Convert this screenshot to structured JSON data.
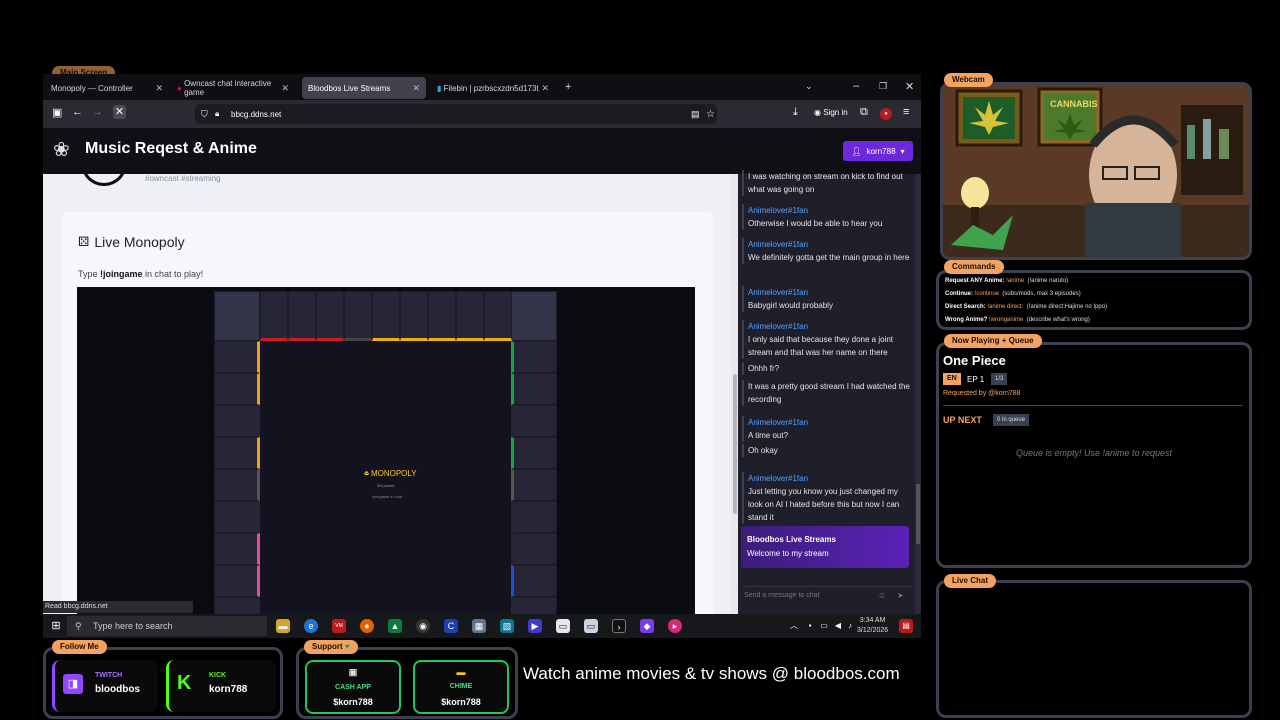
{
  "main_screen_label": "Main Screen",
  "browser": {
    "tabs": [
      {
        "label": "Monopoly — Controller"
      },
      {
        "label": "Owncast chat interactive game"
      },
      {
        "label": "Bloodbos Live Streams"
      },
      {
        "label": "Filebin | pzrbscxzdn5d173t"
      }
    ],
    "url": "bbcg.ddns.net",
    "sign_in": "Sign in",
    "status_text": "Read bbcg.ddns.net"
  },
  "site": {
    "title": "Music Reqest & Anime",
    "user": "korn788",
    "tags": "#owncast  #streaming"
  },
  "monopoly": {
    "title": "Live Monopoly",
    "instruction_prefix": "Type ",
    "instruction_cmd": "!joingame",
    "instruction_suffix": " in chat to play!",
    "logo": "MONOPOLY",
    "joined": "0/6 joined",
    "join_hint": "!joingame in chat"
  },
  "chat": {
    "messages": [
      {
        "name": "",
        "text": "I was watching on stream on kick to find out what was going on"
      },
      {
        "name": "Animelover#1fan",
        "text": "Otherwise I would be able to hear you"
      },
      {
        "name": "Animelover#1fan",
        "text": "We definitely gotta get the main group in here"
      },
      {
        "name": "Animelover#1fan",
        "text": "Babygirl would probably"
      },
      {
        "name": "Animelover#1fan",
        "text": "I only said that because they done a joint stream and that was her name on there"
      },
      {
        "name": "",
        "text": "Ohhh fr?"
      },
      {
        "name": "",
        "text": "It was a pretty good stream I had watched the recording"
      },
      {
        "name": "Animelover#1fan",
        "text": "A time out?"
      },
      {
        "name": "",
        "text": "Oh okay"
      },
      {
        "name": "Animelover#1fan",
        "text": "Just letting you know you just changed my look on AI I hated before this but now I can stand it"
      }
    ],
    "welcome_title": "Bloodbos Live Streams",
    "welcome_text": "Welcome to my stream",
    "input_placeholder": "Send a message to chat"
  },
  "taskbar": {
    "search_placeholder": "Type here to search",
    "time": "3:34 AM",
    "date": "3/12/2026"
  },
  "overlay": {
    "webcam_label": "Webcam",
    "commands_label": "Commands",
    "commands": [
      {
        "key": "Request ANY Anime:",
        "cmd": "!anime",
        "desc": "(!anime naruto)"
      },
      {
        "key": "Continue:",
        "cmd": "!continue",
        "desc": "(subs/mods, max 3 episodes)"
      },
      {
        "key": "Direct Search:",
        "cmd": "!anime direct:",
        "desc": "(!anime direct:Hajime no Ippo)"
      },
      {
        "key": "Wrong Anime?",
        "cmd": "!wronganime",
        "desc": "(describe what's wrong)"
      }
    ],
    "now_playing_label": "Now Playing + Queue",
    "now_title": "One Piece",
    "lang": "EN",
    "episode": "EP 1",
    "ep_count": "1/3",
    "requested_by": "Requested by @korn788",
    "up_next": "UP NEXT",
    "queue_count": "0 in queue",
    "queue_empty": "Queue is empty! Use !anime to request",
    "live_chat_label": "Live Chat",
    "follow_label": "Follow Me",
    "twitch_label": "TWITCH",
    "twitch_user": "bloodbos",
    "kick_label": "KICK",
    "kick_user": "korn788",
    "support_label": "Support",
    "cashapp_label": "CASH APP",
    "cashapp_user": "$korn788",
    "chime_label": "CHIME",
    "chime_user": "$korn788",
    "ad_text": "Watch anime movies & tv shows @ bloodbos.com"
  },
  "colors": {
    "accent": "#f4a261",
    "brand": "#6d28d9",
    "chat_name": "#4fa3ff"
  }
}
